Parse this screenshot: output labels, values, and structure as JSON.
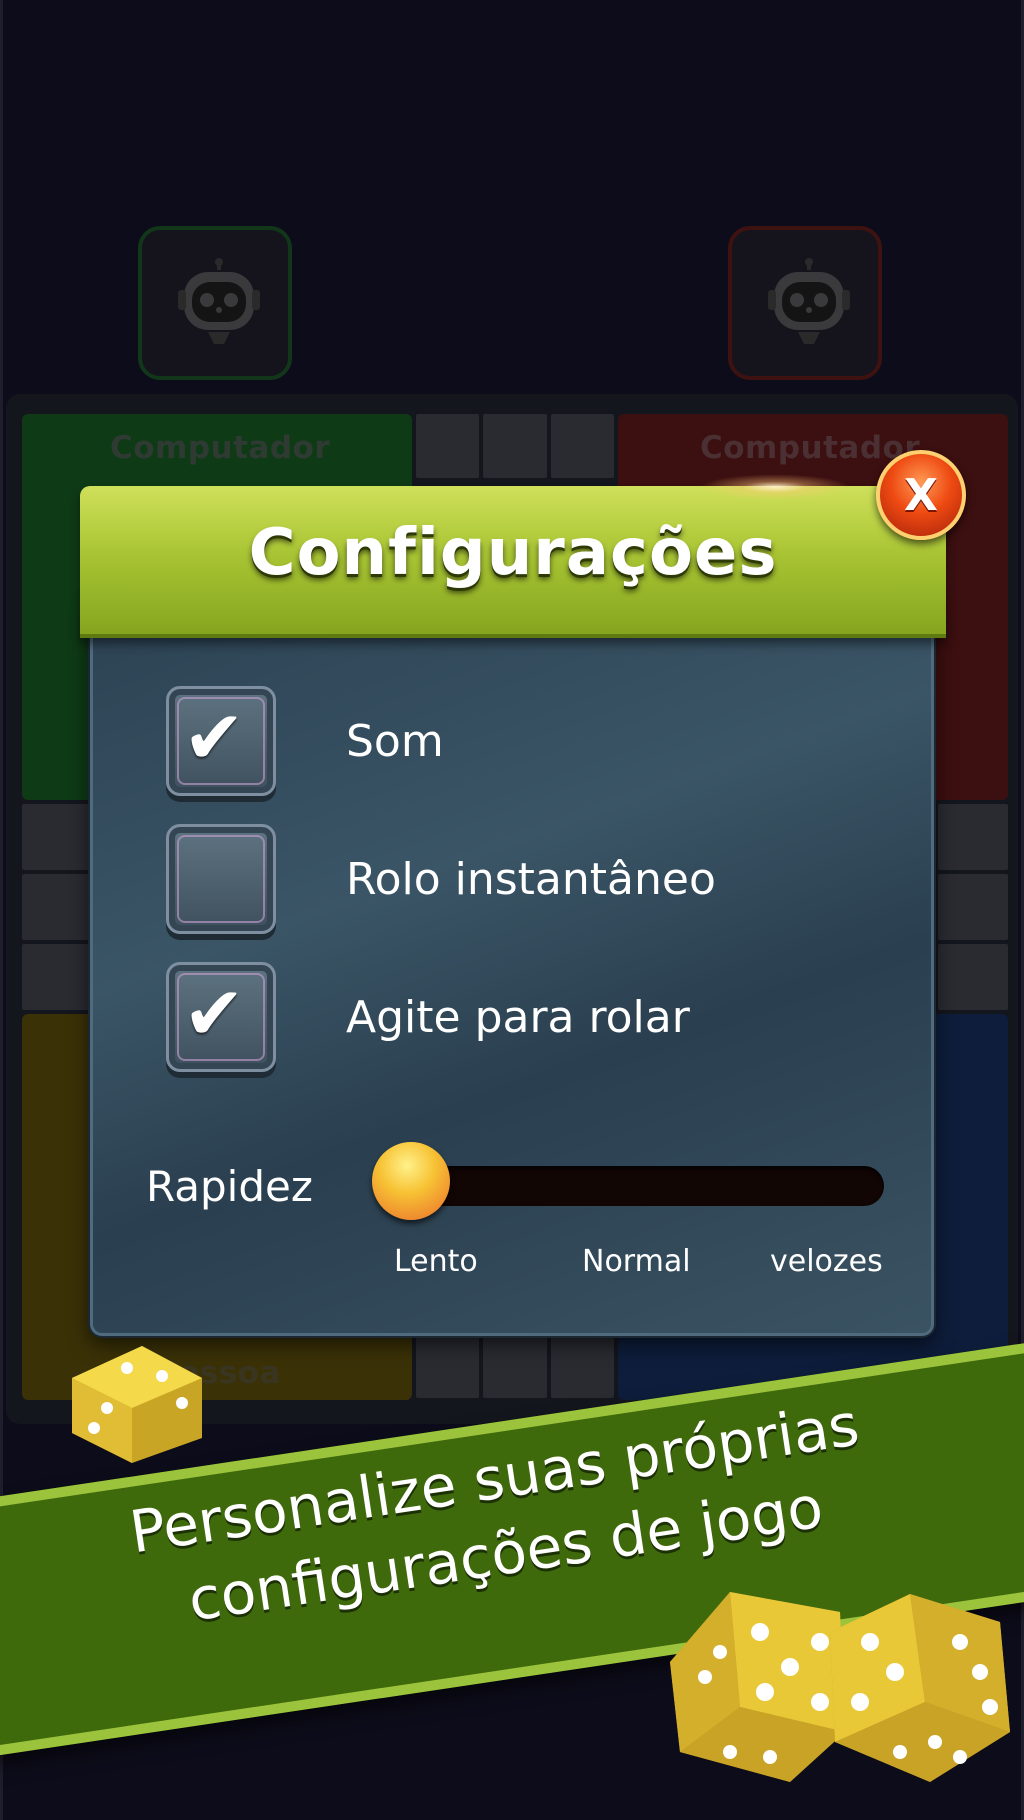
{
  "background": {
    "players": {
      "top_left": "Computador",
      "top_right": "Computador",
      "bottom_left": "Pessoa"
    }
  },
  "dialog": {
    "title": "Configurações",
    "close_label": "X",
    "options": [
      {
        "label": "Som",
        "checked": true
      },
      {
        "label": "Rolo instantâneo",
        "checked": false
      },
      {
        "label": "Agite para rolar",
        "checked": true
      }
    ],
    "check_glyph": "✔",
    "speed": {
      "label": "Rapidez",
      "value": "Lento",
      "ticks": [
        "Lento",
        "Normal",
        "velozes"
      ]
    }
  },
  "banner": {
    "line1": "Personalize suas próprias",
    "line2": "configurações de jogo"
  },
  "colors": {
    "header_green": "#a9c534",
    "close_red": "#ee4a12",
    "banner_green": "#3f6a0c",
    "die_yellow": "#e8c63a"
  }
}
